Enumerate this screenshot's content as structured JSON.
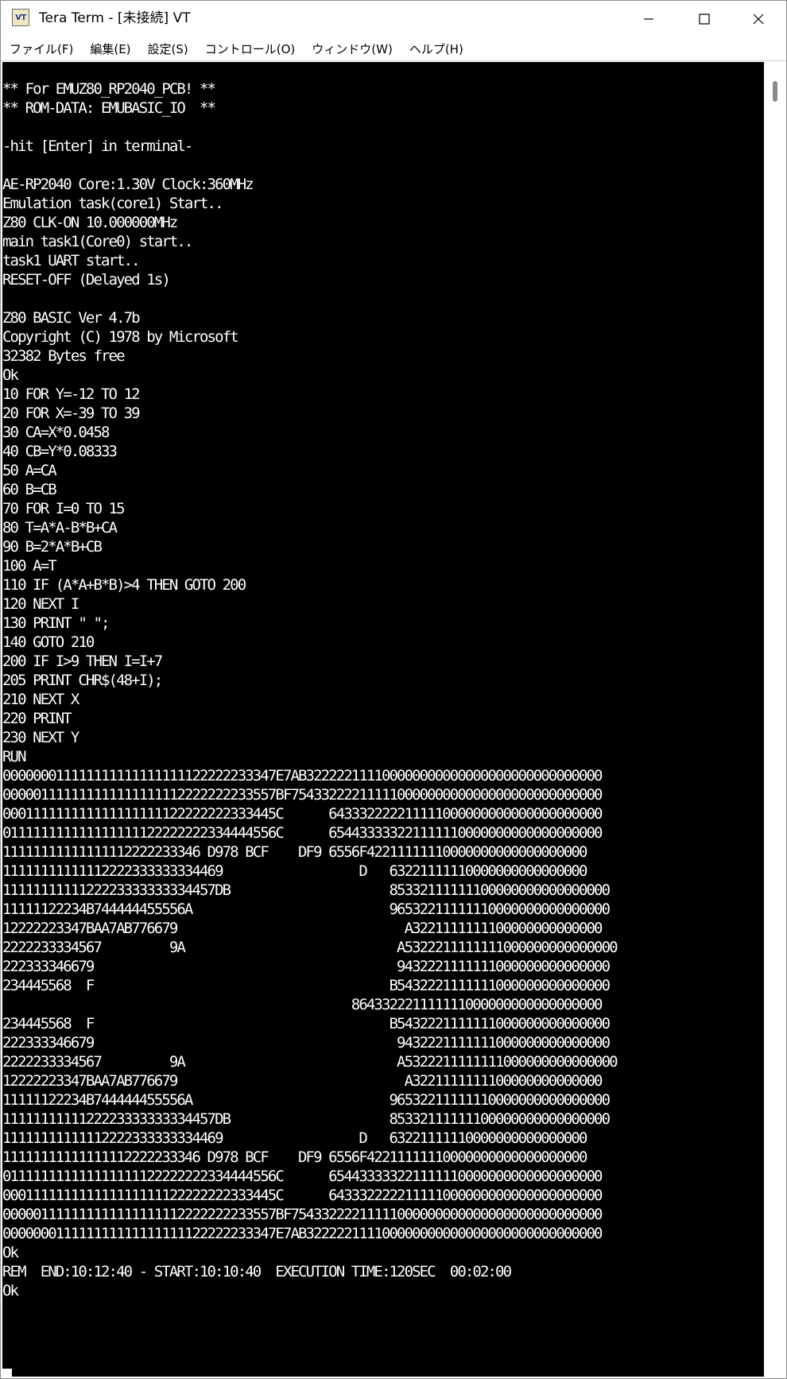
{
  "window": {
    "app_icon_text": "VT",
    "title": "Tera Term - [未接続] VT"
  },
  "menu": [
    {
      "label": "ファイル(F)"
    },
    {
      "label": "編集(E)"
    },
    {
      "label": "設定(S)"
    },
    {
      "label": "コントロール(O)"
    },
    {
      "label": "ウィンドウ(W)"
    },
    {
      "label": "ヘルプ(H)"
    }
  ],
  "terminal": {
    "lines": [
      "** For EMUZ80_RP2040_PCB! **",
      "** ROM-DATA: EMUBASIC_IO  **",
      "",
      "-hit [Enter] in terminal-",
      "",
      "AE-RP2040 Core:1.30V Clock:360MHz",
      "Emulation task(core1) Start..",
      "Z80 CLK-ON 10.000000MHz",
      "main task1(Core0) start..",
      "task1 UART start..",
      "RESET-OFF (Delayed 1s)",
      "",
      "Z80 BASIC Ver 4.7b",
      "Copyright (C) 1978 by Microsoft",
      "32382 Bytes free",
      "Ok",
      "10 FOR Y=-12 TO 12",
      "20 FOR X=-39 TO 39",
      "30 CA=X*0.0458",
      "40 CB=Y*0.08333",
      "50 A=CA",
      "60 B=CB",
      "70 FOR I=0 TO 15",
      "80 T=A*A-B*B+CA",
      "90 B=2*A*B+CB",
      "100 A=T",
      "110 IF (A*A+B*B)>4 THEN GOTO 200",
      "120 NEXT I",
      "130 PRINT \" \";",
      "140 GOTO 210",
      "200 IF I>9 THEN I=I+7",
      "205 PRINT CHR$(48+I);",
      "210 NEXT X",
      "220 PRINT",
      "230 NEXT Y",
      "RUN",
      "000000011111111111111111122222233347E7AB322222111100000000000000000000000000000",
      "000001111111111111111112222222233557BF75433222211111000000000000000000000000000",
      "000111111111111111111122222222333445C      643332222211111000000000000000000000",
      "011111111111111111122222222334444556C      654433333221111110000000000000000000",
      "11111111111111112222233346 D978 BCF    DF9 6556F42211111110000000000000000000",
      "11111111111112222333333334469                  D   63221111110000000000000000",
      "1111111111122223333333334457DB                     85332111111100000000000000000",
      "11111122234B744444455556A                          96532211111110000000000000000",
      "12222223347BAA7AB776679                              A3221111111100000000000000",
      "2222233334567         9A                            A5322211111111000000000000000",
      "222333346679                                        9432221111111000000000000000",
      "234445568  F                                       B5432221111111000000000000000",
      "                                              864332221111111000000000000000000",
      "234445568  F                                       B5432221111111000000000000000",
      "222333346679                                        9432221111111000000000000000",
      "2222233334567         9A                            A5322211111111000000000000000",
      "12222223347BAA7AB776679                              A3221111111100000000000000",
      "11111122234B744444455556A                          96532211111110000000000000000",
      "1111111111122223333333334457DB                     85332111111100000000000000000",
      "11111111111112222333333334469                  D   63221111110000000000000000",
      "11111111111111112222233346 D978 BCF    DF9 6556F42211111110000000000000000000",
      "011111111111111111122222222334444556C      654433333221111110000000000000000000",
      "000111111111111111111122222222333445C      643332222211111000000000000000000000",
      "000001111111111111111112222222233557BF75433222211111000000000000000000000000000",
      "000000011111111111111111122222233347E7AB322222111100000000000000000000000000000",
      "Ok",
      "REM  END:10:12:40 - START:10:10:40  EXECUTION TIME:120SEC  00:02:00",
      "Ok"
    ]
  }
}
